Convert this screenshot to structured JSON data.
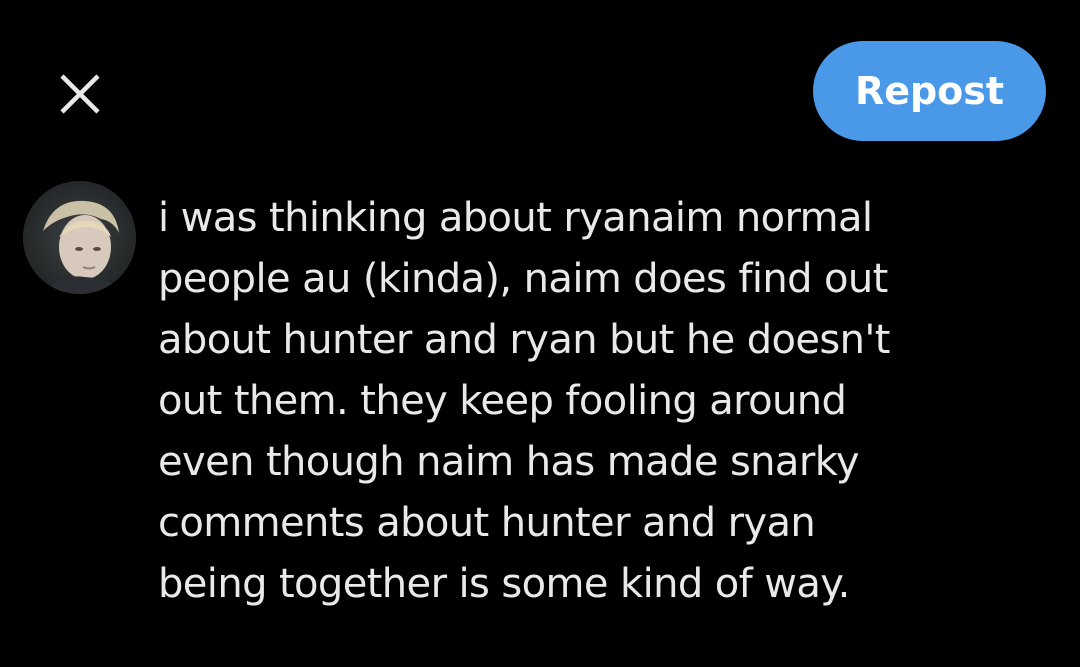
{
  "header": {
    "close_icon": "close-icon",
    "repost_label": "Repost",
    "accent_color": "#4a99e9"
  },
  "post": {
    "avatar_icon": "avatar",
    "text": "i was thinking about ryanaim normal\npeople au (kinda), naim does find out\nabout hunter and ryan but he doesn't\nout them. they keep fooling around\neven though naim has made snarky\ncomments about hunter and ryan\nbeing together is some kind of way."
  }
}
